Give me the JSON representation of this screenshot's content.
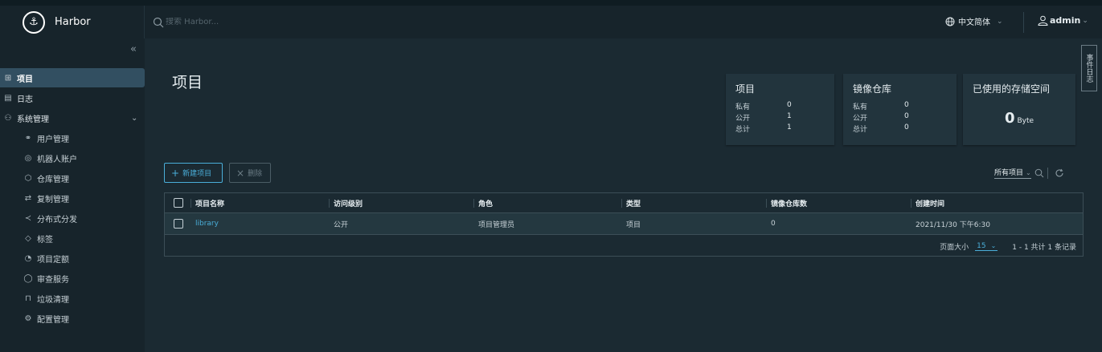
{
  "header": {
    "brand": "Harbor",
    "search_placeholder": "搜索 Harbor...",
    "language": "中文简体",
    "user": "admin"
  },
  "sidebar": {
    "items": [
      {
        "label": "项目",
        "icon": "projects-icon",
        "active": true
      },
      {
        "label": "日志",
        "icon": "log-icon"
      },
      {
        "label": "系统管理",
        "icon": "admin-icon"
      }
    ],
    "admin_items": [
      {
        "label": "用户管理",
        "icon": "users-icon"
      },
      {
        "label": "机器人账户",
        "icon": "robot-icon"
      },
      {
        "label": "仓库管理",
        "icon": "registry-icon"
      },
      {
        "label": "复制管理",
        "icon": "replication-icon"
      },
      {
        "label": "分布式分发",
        "icon": "distribution-icon"
      },
      {
        "label": "标签",
        "icon": "tag-icon"
      },
      {
        "label": "项目定额",
        "icon": "quota-icon"
      },
      {
        "label": "审查服务",
        "icon": "shield-icon"
      },
      {
        "label": "垃圾清理",
        "icon": "trash-icon"
      },
      {
        "label": "配置管理",
        "icon": "gear-icon"
      }
    ]
  },
  "main": {
    "title": "项目",
    "side_tab": "事件日志",
    "cards": {
      "projects": {
        "title": "项目",
        "private_label": "私有",
        "private": "0",
        "public_label": "公开",
        "public": "1",
        "total_label": "总计",
        "total": "1"
      },
      "repos": {
        "title": "镜像仓库",
        "private_label": "私有",
        "private": "0",
        "public_label": "公开",
        "public": "0",
        "total_label": "总计",
        "total": "0"
      },
      "storage": {
        "title": "已使用的存储空间",
        "value": "0",
        "unit": "Byte"
      }
    },
    "buttons": {
      "new_project": "新建项目",
      "delete": "删除"
    },
    "filter": {
      "selected": "所有项目"
    },
    "table": {
      "columns": [
        "项目名称",
        "访问级别",
        "角色",
        "类型",
        "镜像仓库数",
        "创建时间"
      ],
      "rows": [
        {
          "name": "library",
          "access": "公开",
          "role": "项目管理员",
          "type": "项目",
          "repo_count": "0",
          "created": "2021/11/30 下午6:30"
        }
      ],
      "page_size_label": "页面大小",
      "page_size": "15",
      "range": "1 - 1 共计 1 条记录"
    }
  }
}
